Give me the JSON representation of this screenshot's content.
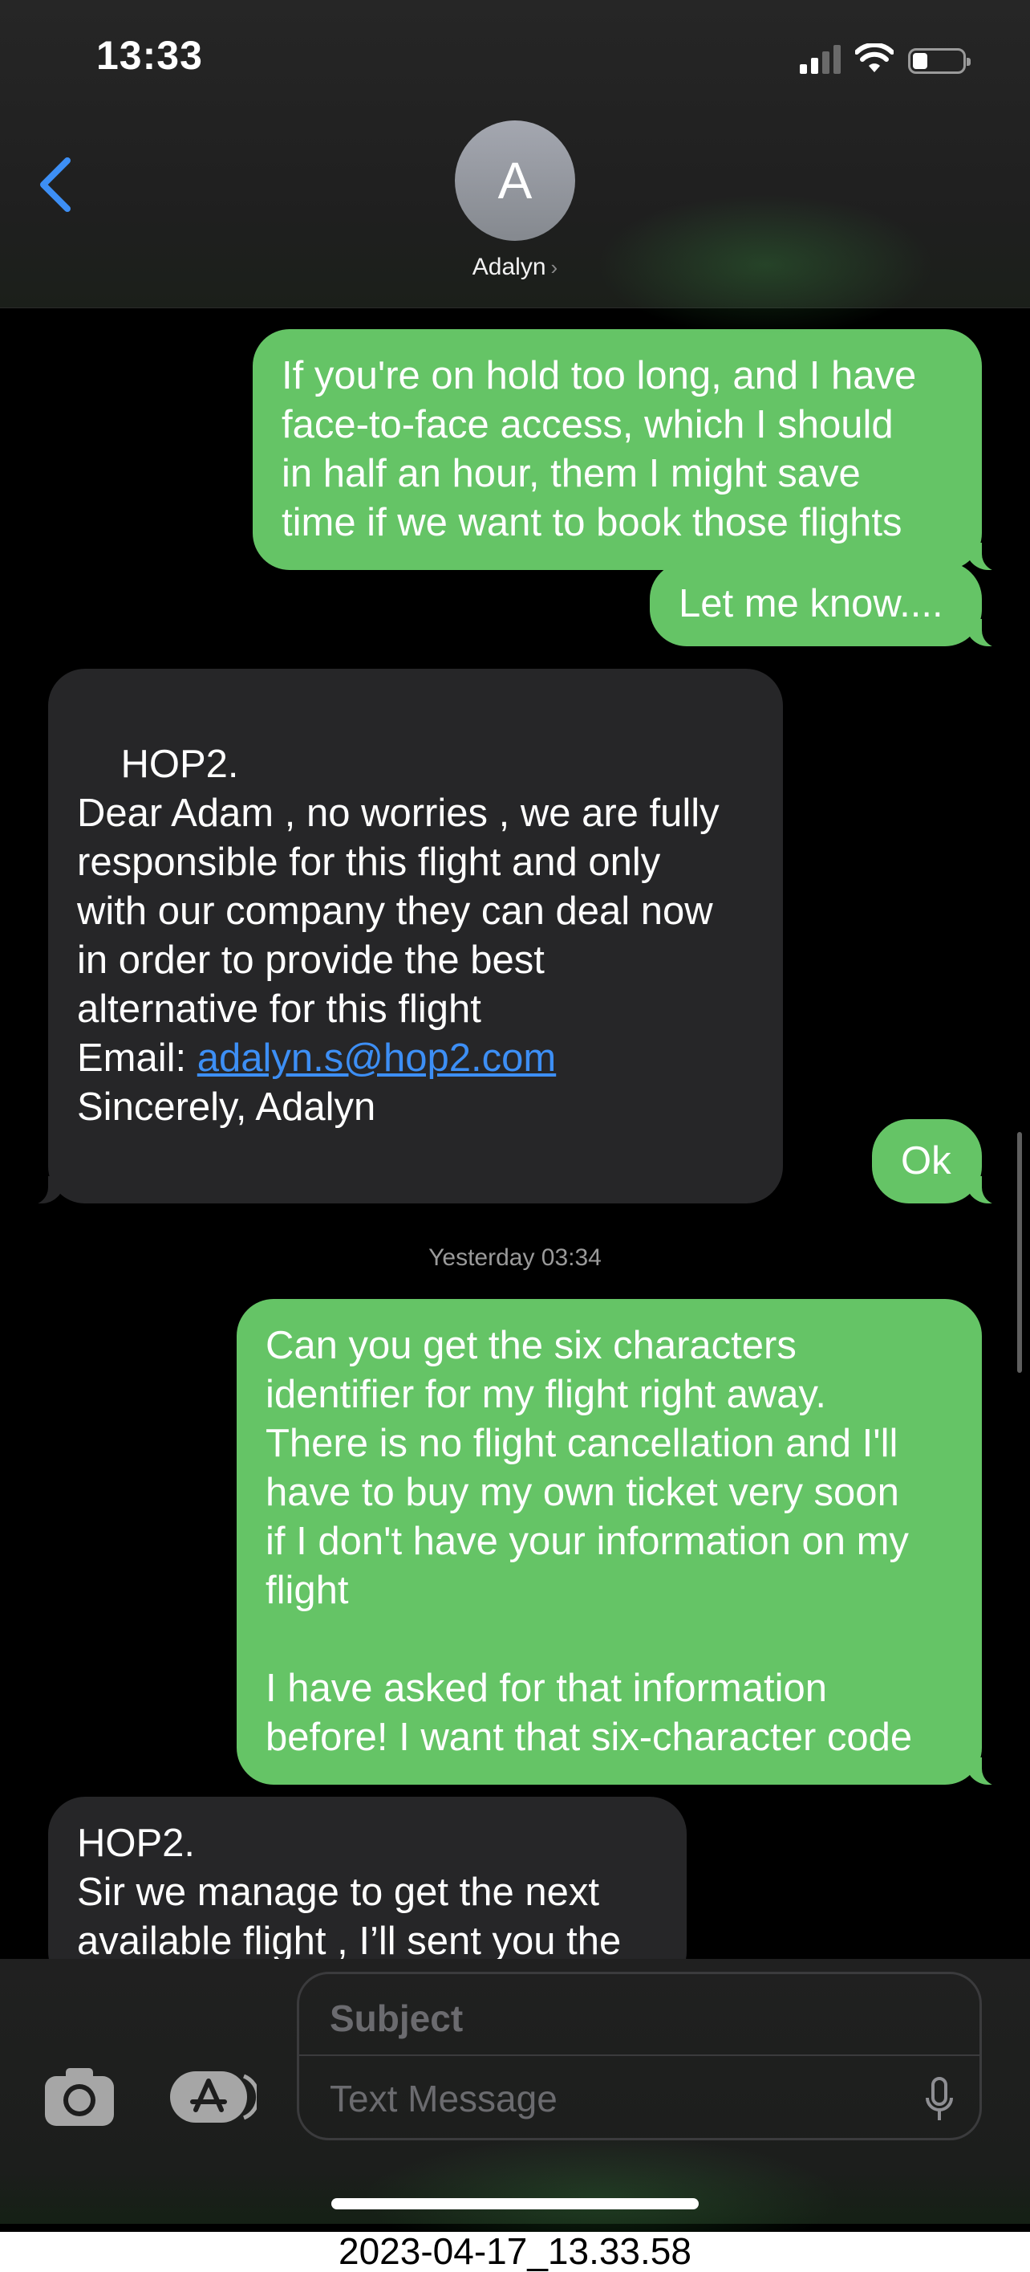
{
  "status_bar": {
    "time": "13:33",
    "battery_level": 0.3
  },
  "header": {
    "avatar_initial": "A",
    "contact_name": "Adalyn",
    "chevron": "›"
  },
  "messages": [
    {
      "type": "sent",
      "text": "If you're on hold too long, and I have\nface-to-face access, which I should\nin half an hour, them I might save\ntime if we want to book those flights"
    },
    {
      "type": "sent",
      "text": "Let me know...."
    },
    {
      "type": "received",
      "text_before_link": "HOP2.\nDear Adam , no worries , we are fully\nresponsible for this flight and only\nwith our company they can deal now\nin order to provide the best\nalternative for this flight\nEmail: ",
      "link": "adalyn.s@hop2.com",
      "text_after_link": "\nSincerely, Adalyn"
    },
    {
      "type": "sent",
      "text": "Ok"
    },
    {
      "type": "sent",
      "text": "Can you get the six characters\nidentifier for my flight right away.\nThere is no flight cancellation and I'll\nhave to buy my own ticket very soon\nif I don't have your information on my\nflight\n\nI have asked for that information\nbefore! I want that six-character code"
    },
    {
      "type": "received",
      "text": "HOP2.\nSir we manage to get the next\navailable flight , I’ll sent you the"
    }
  ],
  "timestamp": {
    "day": "Yesterday",
    "time": "03:34"
  },
  "compose": {
    "subject_placeholder": "Subject",
    "message_placeholder": "Text Message"
  },
  "caption": "2023-04-17_13.33.58",
  "icons": [
    "back-chevron-icon",
    "camera-icon",
    "app-store-icon",
    "mic-icon",
    "wifi-icon",
    "cellular-signal-icon",
    "battery-icon"
  ],
  "colors": {
    "sent_bubble": "#65c466",
    "received_bubble": "#262628",
    "link": "#3d8ff5",
    "back_chevron": "#3d8ff5"
  }
}
